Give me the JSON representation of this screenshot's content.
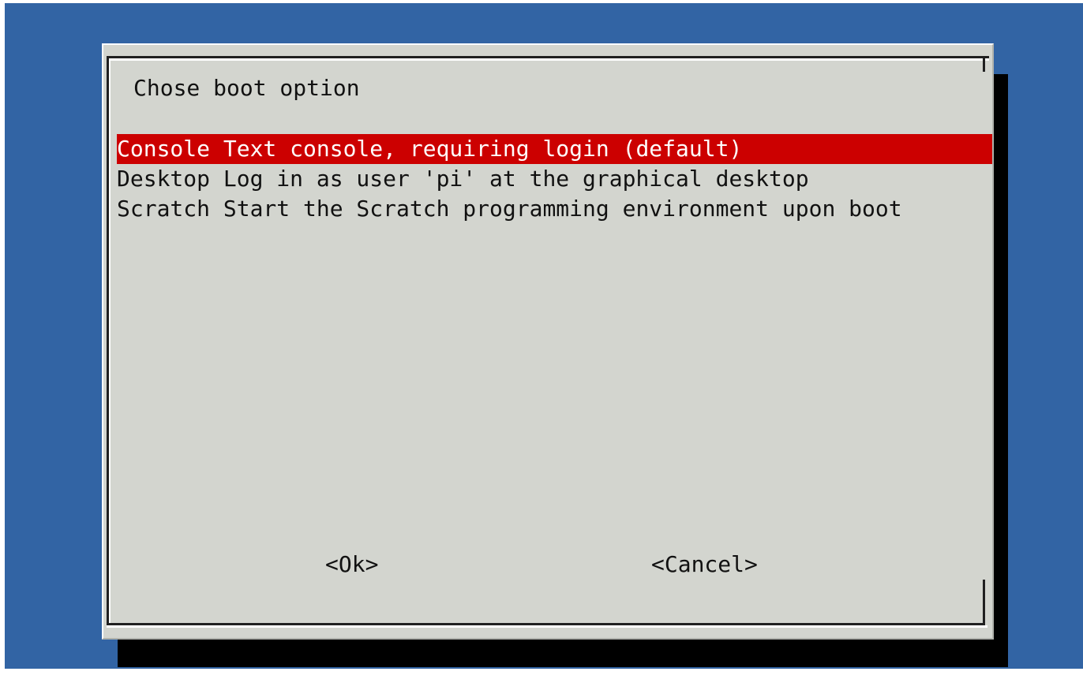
{
  "dialog": {
    "title": "Chose boot option",
    "items": [
      {
        "label": "Console Text console, requiring login (default)",
        "selected": true
      },
      {
        "label": "Desktop Log in as user 'pi' at the graphical desktop",
        "selected": false
      },
      {
        "label": "Scratch Start the Scratch programming environment upon boot",
        "selected": false
      }
    ],
    "ok_label": "<Ok>",
    "cancel_label": "<Cancel>"
  },
  "colors": {
    "screen_background": "#3264a4",
    "dialog_background": "#d3d5cf",
    "selection_background": "#cc0000",
    "selection_text": "#ffffff",
    "shadow": "#000000"
  }
}
